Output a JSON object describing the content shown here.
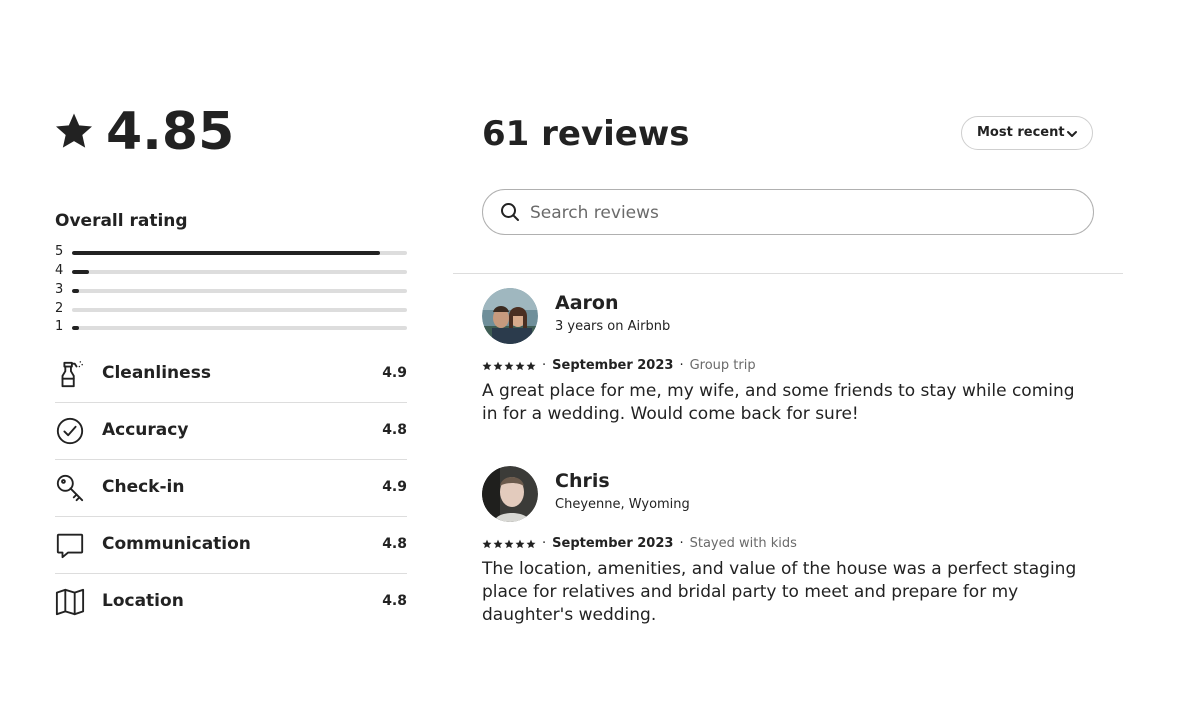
{
  "overall": {
    "rating": "4.85",
    "label": "Overall rating",
    "histogram": [
      {
        "stars": "5",
        "fraction": 0.92
      },
      {
        "stars": "4",
        "fraction": 0.05
      },
      {
        "stars": "3",
        "fraction": 0.02
      },
      {
        "stars": "2",
        "fraction": 0.0
      },
      {
        "stars": "1",
        "fraction": 0.02
      }
    ]
  },
  "categories": [
    {
      "label": "Cleanliness",
      "score": "4.9",
      "icon": "spray-bottle-icon"
    },
    {
      "label": "Accuracy",
      "score": "4.8",
      "icon": "check-circle-icon"
    },
    {
      "label": "Check-in",
      "score": "4.9",
      "icon": "key-icon"
    },
    {
      "label": "Communication",
      "score": "4.8",
      "icon": "chat-bubble-icon"
    },
    {
      "label": "Location",
      "score": "4.8",
      "icon": "map-icon"
    }
  ],
  "reviews_header": {
    "count_label": "61 reviews",
    "sort_label": "Most recent"
  },
  "search": {
    "placeholder": "Search reviews",
    "value": ""
  },
  "reviews": [
    {
      "name": "Aaron",
      "subtitle": "3 years on Airbnb",
      "stars": 5,
      "date": "September 2023",
      "trip": "Group trip",
      "text": "A great place for me, my wife, and some friends to stay while coming in for a wedding. Would come back for sure!"
    },
    {
      "name": "Chris",
      "subtitle": "Cheyenne, Wyoming",
      "stars": 5,
      "date": "September 2023",
      "trip": "Stayed with kids",
      "text": "The location, amenities, and value of the house was a perfect staging place for relatives and bridal party to meet and prepare for my daughter's wedding."
    }
  ],
  "colors": {
    "text": "#222222",
    "muted": "#6a6a6a",
    "border": "#dddddd",
    "track": "#dddddd"
  }
}
